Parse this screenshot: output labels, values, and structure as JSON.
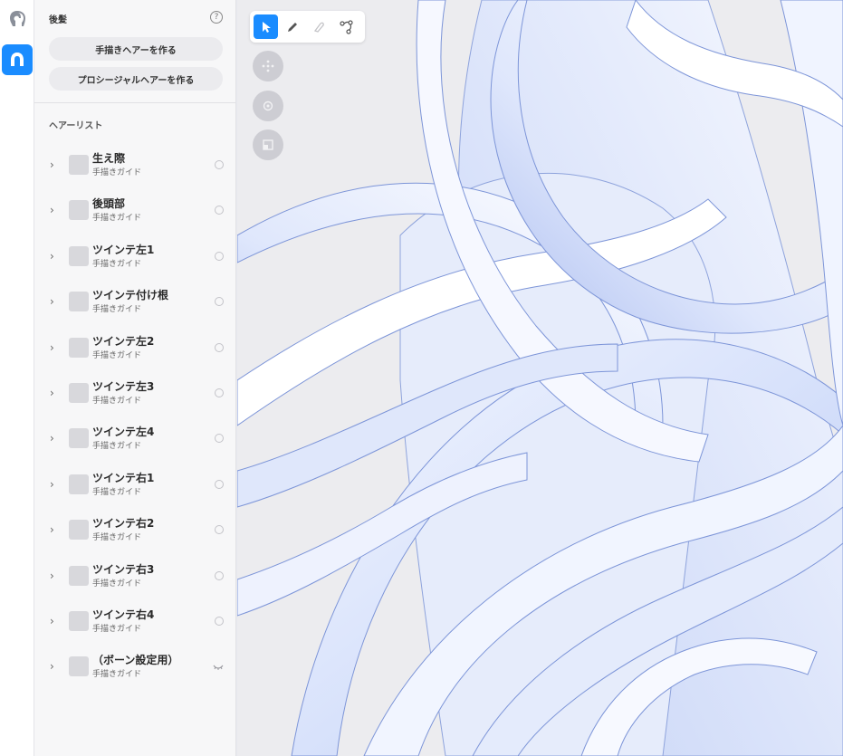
{
  "header": {
    "title": "後髪"
  },
  "actions": {
    "freehand_label": "手描きヘアーを作る",
    "procedural_label": "プロシージャルヘアーを作る"
  },
  "list": {
    "title": "ヘアーリスト",
    "items": [
      {
        "name": "生え際",
        "type": "手描きガイド",
        "visible": true
      },
      {
        "name": "後頭部",
        "type": "手描きガイド",
        "visible": true
      },
      {
        "name": "ツインテ左1",
        "type": "手描きガイド",
        "visible": true
      },
      {
        "name": "ツインテ付け根",
        "type": "手描きガイド",
        "visible": true
      },
      {
        "name": "ツインテ左2",
        "type": "手描きガイド",
        "visible": true
      },
      {
        "name": "ツインテ左3",
        "type": "手描きガイド",
        "visible": true
      },
      {
        "name": "ツインテ左4",
        "type": "手描きガイド",
        "visible": true
      },
      {
        "name": "ツインテ右1",
        "type": "手描きガイド",
        "visible": true
      },
      {
        "name": "ツインテ右2",
        "type": "手描きガイド",
        "visible": true
      },
      {
        "name": "ツインテ右3",
        "type": "手描きガイド",
        "visible": true
      },
      {
        "name": "ツインテ右4",
        "type": "手描きガイド",
        "visible": true
      },
      {
        "name": "（ボーン設定用）",
        "type": "手描きガイド",
        "visible": false
      }
    ]
  },
  "icons": {
    "rail": [
      "head-icon",
      "hair-icon"
    ],
    "tools": [
      "select-arrow-icon",
      "pen-icon",
      "eraser-icon",
      "curve-edit-icon"
    ],
    "view": [
      "move-icon",
      "rotate-icon",
      "fit-view-icon"
    ]
  },
  "colors": {
    "accent": "#1a8cff",
    "hair_fill": "#dbe4fb",
    "hair_outline": "#7d95d8",
    "background": "#ececef"
  }
}
